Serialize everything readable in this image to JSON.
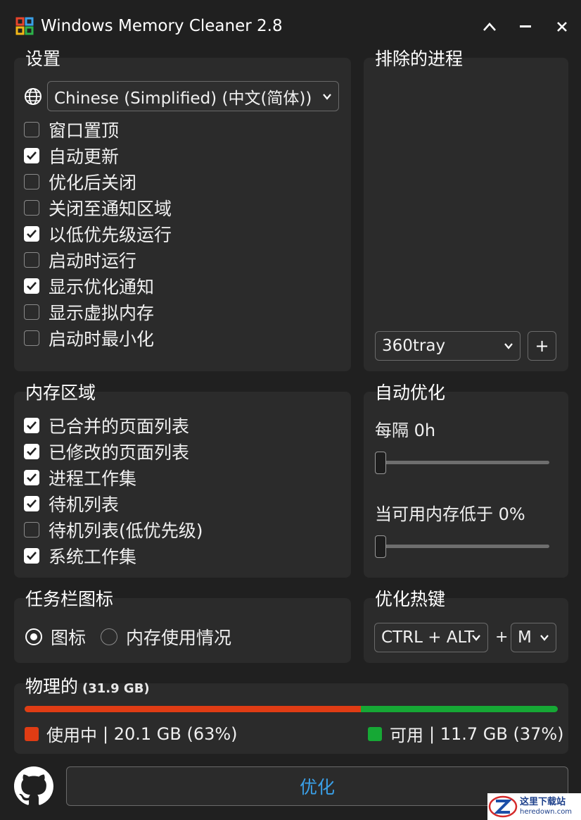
{
  "window": {
    "title": "Windows Memory Cleaner 2.8",
    "controls": {
      "collapse": "^",
      "minimize": "—",
      "close": "✕"
    }
  },
  "settings": {
    "title": "设置",
    "language": "Chinese (Simplified) (中文(简体))",
    "options": [
      {
        "label": "窗口置顶",
        "checked": false
      },
      {
        "label": "自动更新",
        "checked": true
      },
      {
        "label": "优化后关闭",
        "checked": false
      },
      {
        "label": "关闭至通知区域",
        "checked": false
      },
      {
        "label": "以低优先级运行",
        "checked": true
      },
      {
        "label": "启动时运行",
        "checked": false
      },
      {
        "label": "显示优化通知",
        "checked": true
      },
      {
        "label": "显示虚拟内存",
        "checked": false
      },
      {
        "label": "启动时最小化",
        "checked": false
      }
    ]
  },
  "excluded": {
    "title": "排除的进程",
    "process_select": "360tray",
    "add_label": "+"
  },
  "memory_areas": {
    "title": "内存区域",
    "options": [
      {
        "label": "已合并的页面列表",
        "checked": true
      },
      {
        "label": "已修改的页面列表",
        "checked": true
      },
      {
        "label": "进程工作集",
        "checked": true
      },
      {
        "label": "待机列表",
        "checked": true
      },
      {
        "label": "待机列表(低优先级)",
        "checked": false
      },
      {
        "label": "系统工作集",
        "checked": true
      }
    ]
  },
  "auto_optimize": {
    "title": "自动优化",
    "interval_label": "每隔 0h",
    "interval_value": 0,
    "low_memory_label": "当可用内存低于 0%",
    "low_memory_value": 0
  },
  "tray_icon": {
    "title": "任务栏图标",
    "options": [
      {
        "label": "图标",
        "selected": true
      },
      {
        "label": "内存使用情况",
        "selected": false
      }
    ]
  },
  "hotkey": {
    "title": "优化热键",
    "modifier": "CTRL + ALT",
    "plus": "+",
    "key": "M"
  },
  "physical": {
    "title": "物理的",
    "total": "(31.9 GB)",
    "used_fraction": 0.63,
    "used_label": "使用中",
    "used_value": "| 20.1 GB (63%)",
    "free_label": "可用",
    "free_value": "| 11.7 GB (37%)",
    "used_color": "#e03c14",
    "free_color": "#16a835"
  },
  "footer": {
    "optimize_label": "优化",
    "optimize_color": "#3aa0e8"
  },
  "watermark": {
    "text": "这里下载站",
    "site": "heredown.com"
  }
}
